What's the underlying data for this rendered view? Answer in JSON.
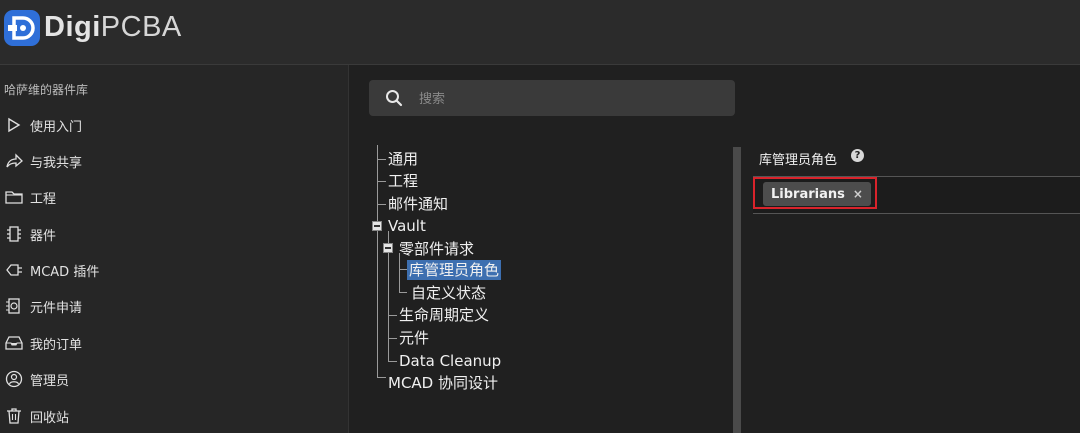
{
  "app": {
    "logo_bold": "Digi",
    "logo_regular": "PCBA"
  },
  "sidebar": {
    "library_title": "哈萨维的器件库",
    "items": [
      {
        "label": "使用入门",
        "icon": "play-icon"
      },
      {
        "label": "与我共享",
        "icon": "share-icon"
      },
      {
        "label": "工程",
        "icon": "folder-icon"
      },
      {
        "label": "器件",
        "icon": "chip-icon"
      },
      {
        "label": "MCAD 插件",
        "icon": "plugin-icon"
      },
      {
        "label": "元件申请",
        "icon": "request-icon"
      },
      {
        "label": "我的订单",
        "icon": "inbox-icon"
      },
      {
        "label": "管理员",
        "icon": "admin-icon"
      },
      {
        "label": "回收站",
        "icon": "trash-icon"
      }
    ]
  },
  "search": {
    "placeholder": "搜索",
    "value": ""
  },
  "tree": {
    "nodes": {
      "general": "通用",
      "project": "工程",
      "mail": "邮件通知",
      "vault": "Vault",
      "part_request": "零部件请求",
      "librarian_role": "库管理员角色",
      "custom_status": "自定义状态",
      "lifecycle": "生命周期定义",
      "component": "元件",
      "data_cleanup": "Data Cleanup",
      "mcad_collab": "MCAD 协同设计"
    },
    "selected": "库管理员角色"
  },
  "detail": {
    "title": "库管理员角色",
    "help": "?",
    "tags": [
      {
        "label": "Librarians",
        "close": "×"
      }
    ]
  },
  "colors": {
    "accent": "#2f6fd8",
    "selection": "#3d6fb0",
    "highlight_border": "#d9232b"
  }
}
